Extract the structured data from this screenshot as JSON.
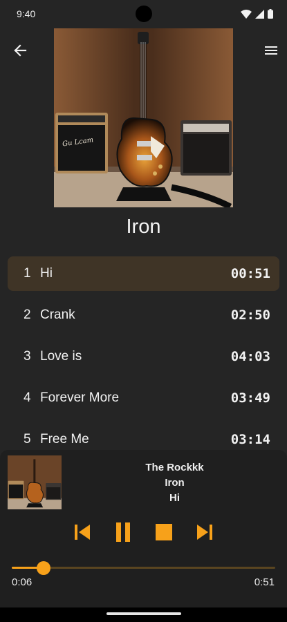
{
  "status_bar": {
    "time": "9:40",
    "icons": [
      "wifi-icon",
      "signal-icon",
      "battery-icon"
    ]
  },
  "header": {
    "back_icon": "arrow-left-icon",
    "menu_icon": "hamburger-menu-icon"
  },
  "album": {
    "title": "Iron",
    "amp_logo": "Gu Lcam"
  },
  "tracks": [
    {
      "number": "1",
      "title": "Hi",
      "duration": "00:51",
      "active": true
    },
    {
      "number": "2",
      "title": "Crank",
      "duration": "02:50",
      "active": false
    },
    {
      "number": "3",
      "title": "Love is",
      "duration": "04:03",
      "active": false
    },
    {
      "number": "4",
      "title": "Forever More",
      "duration": "03:49",
      "active": false
    },
    {
      "number": "5",
      "title": "Free Me",
      "duration": "03:14",
      "active": false
    }
  ],
  "now_playing": {
    "artist": "The Rockkk",
    "album": "Iron",
    "track": "Hi"
  },
  "controls": {
    "icons": [
      "skip-previous-icon",
      "pause-icon",
      "stop-icon",
      "skip-next-icon"
    ]
  },
  "progress": {
    "current": "0:06",
    "total": "0:51",
    "fraction": 0.12
  },
  "colors": {
    "accent": "#f7a11a",
    "background": "#252525",
    "active_row": "#3f3426",
    "player_background": "#1f1f1f"
  }
}
